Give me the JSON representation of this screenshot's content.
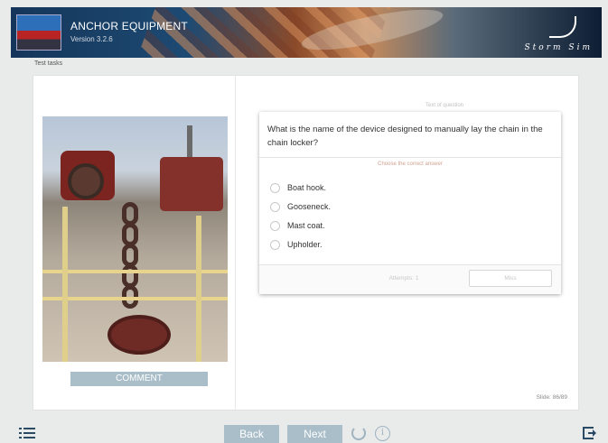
{
  "header": {
    "title": "ANCHOR EQUIPMENT",
    "subtitle": "Version 3.2.6",
    "logo_text": "Storm Sim"
  },
  "breadcrumb": "Test tasks",
  "left_panel": {
    "comment_label": "COMMENT"
  },
  "question_section": {
    "label": "Text of question",
    "question": "What is the name of the device designed to manually lay the chain in the chain locker?",
    "instruction": "Choose the correct answer",
    "options": [
      {
        "label": "Boat hook."
      },
      {
        "label": "Gooseneck."
      },
      {
        "label": "Mast coat."
      },
      {
        "label": "Upholder."
      }
    ],
    "attempts_text": "Attempts: 1",
    "miss_label": "Miss"
  },
  "slide_counter": "Slide: 86/89",
  "navigation": {
    "back_label": "Back",
    "next_label": "Next",
    "info_glyph": "i"
  },
  "icons": {
    "menu": "menu-list-icon",
    "reload": "reload-icon",
    "info": "info-icon",
    "exit": "exit-icon"
  },
  "colors": {
    "accent_button": "#a9bec9",
    "icon_dark": "#2b4a66"
  }
}
